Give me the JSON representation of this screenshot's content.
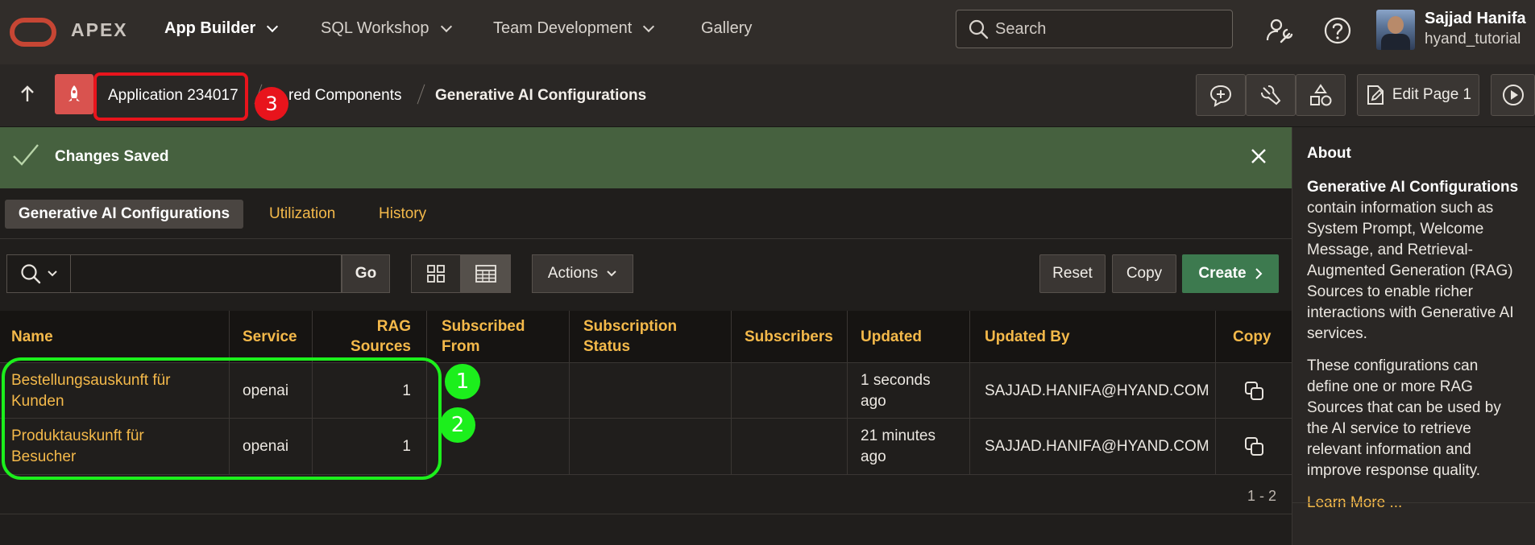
{
  "topnav": {
    "brand": "APEX",
    "items": [
      {
        "label": "App Builder",
        "active": true,
        "has_menu": true
      },
      {
        "label": "SQL Workshop",
        "active": false,
        "has_menu": true
      },
      {
        "label": "Team Development",
        "active": false,
        "has_menu": true
      },
      {
        "label": "Gallery",
        "active": false,
        "has_menu": false
      }
    ],
    "search_placeholder": "Search",
    "user_name": "Sajjad Hanifa",
    "workspace": "hyand_tutorial"
  },
  "breadcrumb": {
    "items": [
      "Application 234017",
      "Shared Components",
      "Generative AI Configurations"
    ],
    "visible": [
      "Application 234017",
      "red Components",
      "Generative AI Configurations"
    ]
  },
  "toolbar": {
    "edit_page_label": "Edit Page 1"
  },
  "banner": {
    "message": "Changes Saved"
  },
  "tabs": [
    {
      "label": "Generative AI Configurations",
      "active": true
    },
    {
      "label": "Utilization",
      "active": false
    },
    {
      "label": "History",
      "active": false
    }
  ],
  "report_toolbar": {
    "search_value": "",
    "go_label": "Go",
    "actions_label": "Actions",
    "reset_label": "Reset",
    "copy_label": "Copy",
    "create_label": "Create"
  },
  "table": {
    "columns": [
      {
        "label": "Name"
      },
      {
        "label": "Service"
      },
      {
        "label": "RAG Sources"
      },
      {
        "label": "Subscribed From"
      },
      {
        "label": "Subscription Status"
      },
      {
        "label": "Subscribers"
      },
      {
        "label": "Updated"
      },
      {
        "label": "Updated By"
      },
      {
        "label": "Copy"
      }
    ],
    "rows": [
      {
        "name": "Bestellungsauskunft für Kunden",
        "service": "openai",
        "rag_sources": "1",
        "subscribed_from": "",
        "subscription_status": "",
        "subscribers": "",
        "updated": "1 seconds ago",
        "updated_by": "SAJJAD.HANIFA@HYAND.COM"
      },
      {
        "name": "Produktauskunft für Besucher",
        "service": "openai",
        "rag_sources": "1",
        "subscribed_from": "",
        "subscription_status": "",
        "subscribers": "",
        "updated": "21 minutes ago",
        "updated_by": "SAJJAD.HANIFA@HYAND.COM"
      }
    ],
    "pagination": "1 - 2"
  },
  "sidebar": {
    "title": "About",
    "heading": "Generative AI Configurations",
    "para1_rest": " contain information such as System Prompt, Welcome Message, and Retrieval-Augmented Generation (RAG) Sources to enable richer interactions with Generative AI services.",
    "para2": "These configurations can define one or more RAG Sources that can be used by the AI service to retrieve relevant information and improve response quality.",
    "learn_more": "Learn More ..."
  },
  "annotations": [
    {
      "number": "1",
      "color": "#1cef1c"
    },
    {
      "number": "2",
      "color": "#1cef1c"
    },
    {
      "number": "3",
      "color": "#e8141c"
    }
  ],
  "colors": {
    "accent_link": "#f4b94a",
    "banner_success": "#46613f",
    "create_button": "#3d7a4f",
    "brand_red": "#c74634"
  }
}
